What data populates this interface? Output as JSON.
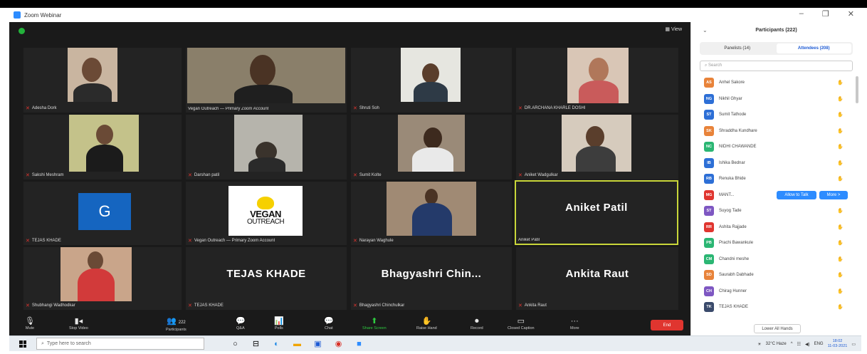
{
  "window": {
    "title": "Zoom Webinar"
  },
  "view_label": "View",
  "tiles": [
    {
      "name": "Adesha Dork",
      "mic_muted": true
    },
    {
      "name": "Vegan Outreach — Primary Zoom Account",
      "mic_muted": false
    },
    {
      "name": "Shruti Soh",
      "mic_muted": true
    },
    {
      "name": "DR.ARCHANA KHARLE DOSHI",
      "mic_muted": true
    },
    {
      "name": "Sakshi Meshram",
      "mic_muted": true
    },
    {
      "name": "Darshan patil",
      "mic_muted": true
    },
    {
      "name": "Sumit Kolte",
      "mic_muted": true
    },
    {
      "name": "Aniket Wadgulkar",
      "mic_muted": true
    },
    {
      "name": "TEJAS KHADE",
      "mic_muted": true,
      "avatar_letter": "G"
    },
    {
      "name": "Vegan Outreach — Primary Zoom Account",
      "mic_muted": true,
      "logo_line1": "VEGAN",
      "logo_line2": "OUTREACH"
    },
    {
      "name": "Narayan Waghule",
      "mic_muted": true
    },
    {
      "name": "Aniket Patil",
      "mic_muted": false,
      "display": "Aniket Patil"
    },
    {
      "name": "Shubhangi Wadhodkar",
      "mic_muted": true
    },
    {
      "name": "TEJAS KHADE",
      "mic_muted": true,
      "display": "TEJAS KHADE"
    },
    {
      "name": "Bhagyashri Chinchulkar",
      "mic_muted": true,
      "display": "Bhagyashri  Chin..."
    },
    {
      "name": "Ankita Raut",
      "mic_muted": true,
      "display": "Ankita Raut"
    }
  ],
  "toolbar": {
    "mute": "Mute",
    "stop_video": "Stop Video",
    "participants": "Participants",
    "participants_count": "222",
    "qa": "Q&A",
    "polls": "Polls",
    "chat": "Chat",
    "share_screen": "Share Screen",
    "raise_hand": "Raise Hand",
    "record": "Record",
    "closed_caption": "Closed Caption",
    "more": "More",
    "end": "End"
  },
  "panel": {
    "title": "Participants (222)",
    "tab_panelists": "Panelists (14)",
    "tab_attendees": "Attendees (208)",
    "search_placeholder": "Search",
    "allow_talk": "Allow to Talk",
    "more": "More >",
    "lower_all": "Lower All Hands",
    "participants": [
      {
        "initials": "AS",
        "name": "Anhel Sakore",
        "color": "#e8833a"
      },
      {
        "initials": "NG",
        "name": "Nikhil Ghyar",
        "color": "#2d6fd6"
      },
      {
        "initials": "ST",
        "name": "Sumit Tathode",
        "color": "#2d6fd6"
      },
      {
        "initials": "SK",
        "name": "Shraddha Kundhare",
        "color": "#e8833a"
      },
      {
        "initials": "NC",
        "name": "NIDHI CHAWANDE",
        "color": "#2bb673"
      },
      {
        "initials": "IB",
        "name": "Ishika Bednar",
        "color": "#2d6fd6"
      },
      {
        "initials": "RB",
        "name": "Renuka Bhide",
        "color": "#2d6fd6"
      },
      {
        "initials": "MG",
        "name": "MANT...",
        "color": "#e0352f",
        "active": true
      },
      {
        "initials": "ST",
        "name": "Suyog Tade",
        "color": "#7e57c2"
      },
      {
        "initials": "RR",
        "name": "Ashita Rajjade",
        "color": "#e0352f"
      },
      {
        "initials": "PB",
        "name": "Prachi Bawankule",
        "color": "#2bb673"
      },
      {
        "initials": "CM",
        "name": "Chandni meshe",
        "color": "#2bb673"
      },
      {
        "initials": "SD",
        "name": "Saurabh Dabhade",
        "color": "#e8833a"
      },
      {
        "initials": "CH",
        "name": "Chirag Hunner",
        "color": "#7e57c2"
      },
      {
        "initials": "TK",
        "name": "TEJAS KHADE",
        "color": "#3a4a6b"
      }
    ]
  },
  "taskbar": {
    "search_placeholder": "Type here to search",
    "weather": "32°C Haze",
    "time": "18:02",
    "date": "11-03-2021",
    "lang": "ENG"
  }
}
